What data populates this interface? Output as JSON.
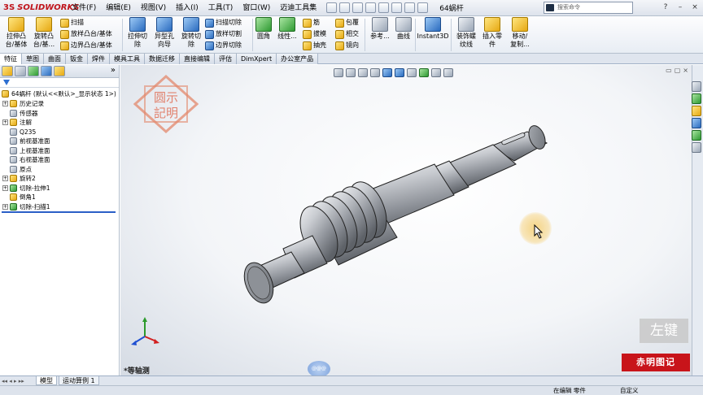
{
  "app": {
    "logo_text": "SOLIDWORKS",
    "logo_mark": "3S",
    "document_title": "64蜗杆",
    "search_placeholder": "搜索命令"
  },
  "menus": [
    "文件(F)",
    "编辑(E)",
    "视图(V)",
    "插入(I)",
    "工具(T)",
    "窗口(W)",
    "迈迪工具集"
  ],
  "ribbon": {
    "extrude_boss": "拉伸凸\n台/基体",
    "revolve_boss": "旋转凸\n台/基...",
    "sweep": "扫描",
    "loft_boss": "放样凸台/基体",
    "boundary_boss": "边界凸台/基体",
    "extrude_cut": "拉伸切\n除",
    "hole_wizard": "异型孔\n向导",
    "revolve_cut": "旋转切\n除",
    "swept_cut": "扫描切除",
    "lofted_cut": "放样切割",
    "boundary_cut": "边界切除",
    "fillet": "圆角",
    "linear_pattern": "线性...",
    "rib": "筋",
    "draft": "拔模",
    "shell": "抽壳",
    "wrap": "包覆",
    "intersect": "相交",
    "mirror": "镜向",
    "reference": "参考...",
    "curves": "曲线",
    "instant3d": "Instant3D",
    "cosmetic_thread": "装饰螺\n纹线",
    "insert_part": "插入零\n件",
    "move_copy": "移动/\n复制..."
  },
  "tabs": [
    {
      "label": "特征",
      "active": true
    },
    {
      "label": "草图",
      "active": false
    },
    {
      "label": "曲面",
      "active": false
    },
    {
      "label": "钣金",
      "active": false
    },
    {
      "label": "焊件",
      "active": false
    },
    {
      "label": "模具工具",
      "active": false
    },
    {
      "label": "数据迁移",
      "active": false
    },
    {
      "label": "直接编辑",
      "active": false
    },
    {
      "label": "评估",
      "active": false
    },
    {
      "label": "DimXpert",
      "active": false
    },
    {
      "label": "办公室产品",
      "active": false
    }
  ],
  "tree": {
    "root": "64蜗杆  (默认<<默认>_显示状态 1>)",
    "items": [
      {
        "label": "历史记录",
        "expandable": true,
        "icon": "history-icon"
      },
      {
        "label": "传感器",
        "expandable": false,
        "icon": "sensor-icon"
      },
      {
        "label": "注解",
        "expandable": true,
        "icon": "annotation-icon"
      },
      {
        "label": "Q235",
        "expandable": false,
        "icon": "material-icon"
      },
      {
        "label": "前视基准面",
        "expandable": false,
        "icon": "plane-icon"
      },
      {
        "label": "上视基准面",
        "expandable": false,
        "icon": "plane-icon"
      },
      {
        "label": "右视基准面",
        "expandable": false,
        "icon": "plane-icon"
      },
      {
        "label": "原点",
        "expandable": false,
        "icon": "origin-icon"
      },
      {
        "label": "旋转2",
        "expandable": true,
        "icon": "revolve-icon"
      },
      {
        "label": "切除-拉伸1",
        "expandable": true,
        "icon": "cut-extrude-icon"
      },
      {
        "label": "倒角1",
        "expandable": false,
        "icon": "chamfer-icon"
      },
      {
        "label": "切除-扫描1",
        "expandable": true,
        "icon": "cut-sweep-icon"
      }
    ]
  },
  "viewport": {
    "view_name": "*等轴测",
    "stamp_text_top": "圆示",
    "stamp_text_bottom": "記明",
    "watermark_key": "左键",
    "watermark_brand": "赤明图记",
    "badge_text": "@@@"
  },
  "bottom_tabs": [
    {
      "label": "模型",
      "active": true
    },
    {
      "label": "运动算例 1",
      "active": false
    }
  ],
  "status": {
    "left": "在编辑 零件",
    "right": "自定义"
  },
  "colors": {
    "logo_red": "#c0141b",
    "accent_blue": "#2b5fc7",
    "watermark_red": "#c8141a"
  }
}
